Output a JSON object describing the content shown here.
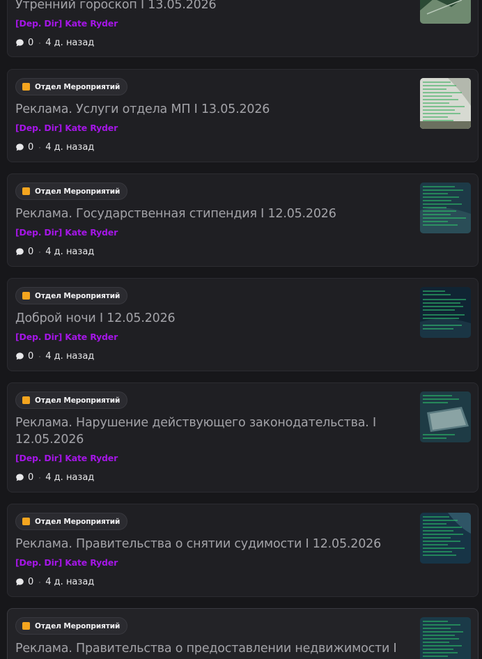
{
  "posts": [
    {
      "tag": "",
      "title": "Утренний гороскоп I 13.05.2026",
      "author": "[Dep. Dir] Kate Ryder",
      "comments": "0",
      "time": "4 д. назад",
      "thumb_style": "outdoor"
    },
    {
      "tag": "Отдел Мероприятий",
      "title": "Реклама. Услуги отдела МП I 13.05.2026",
      "author": "[Dep. Dir] Kate Ryder",
      "comments": "0",
      "time": "4 д. назад",
      "thumb_style": "light"
    },
    {
      "tag": "Отдел Мероприятий",
      "title": "Реклама. Государственная стипендия I 12.05.2026",
      "author": "[Dep. Dir] Kate Ryder",
      "comments": "0",
      "time": "4 д. назад",
      "thumb_style": "dark"
    },
    {
      "tag": "Отдел Мероприятий",
      "title": "Доброй ночи I 12.05.2026",
      "author": "[Dep. Dir] Kate Ryder",
      "comments": "0",
      "time": "4 д. назад",
      "thumb_style": "night"
    },
    {
      "tag": "Отдел Мероприятий",
      "title": "Реклама. Нарушение действующего законодательства. I 12.05.2026",
      "author": "[Dep. Dir] Kate Ryder",
      "comments": "0",
      "time": "4 д. назад",
      "thumb_style": "dark"
    },
    {
      "tag": "Отдел Мероприятий",
      "title": "Реклама. Правительства о снятии судимости I 12.05.2026",
      "author": "[Dep. Dir] Kate Ryder",
      "comments": "0",
      "time": "4 д. назад",
      "thumb_style": "dark"
    },
    {
      "tag": "Отдел Мероприятий",
      "title": "Реклама. Правительства о предоставлении недвижимости I",
      "author": "",
      "comments": "",
      "time": "",
      "thumb_style": "dark"
    }
  ],
  "colors": {
    "tag_square": "#f5a51f",
    "author": "#a416e6",
    "title": "#a3a3a8"
  },
  "icons": {
    "comment": "speech-bubble-icon"
  }
}
